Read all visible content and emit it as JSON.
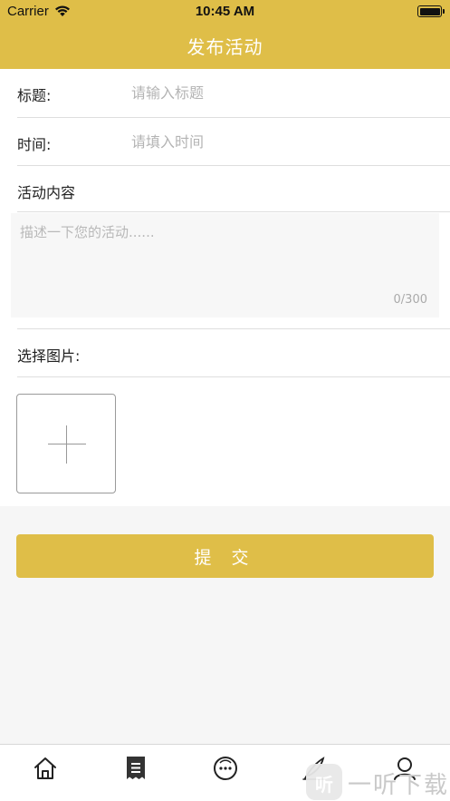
{
  "status_bar": {
    "carrier": "Carrier",
    "time": "10:45 AM"
  },
  "nav": {
    "title": "发布活动"
  },
  "form": {
    "title_label": "标题:",
    "title_placeholder": "请输入标题",
    "time_label": "时间:",
    "time_placeholder": "请填入时间",
    "content_label": "活动内容",
    "content_placeholder": "描述一下您的活动......",
    "char_counter": "0/300",
    "image_label": "选择图片:"
  },
  "submit_label": "提 交",
  "tabbar": {
    "items": [
      {
        "icon": "home-icon"
      },
      {
        "icon": "receipt-icon"
      },
      {
        "icon": "chat-icon"
      },
      {
        "icon": "quill-icon"
      },
      {
        "icon": "user-icon"
      }
    ]
  },
  "watermark": {
    "logo_glyph": "听",
    "text": "一听下载"
  },
  "colors": {
    "accent": "#dfbe48",
    "background": "#f6f6f6",
    "placeholder": "#b4b4b4"
  }
}
